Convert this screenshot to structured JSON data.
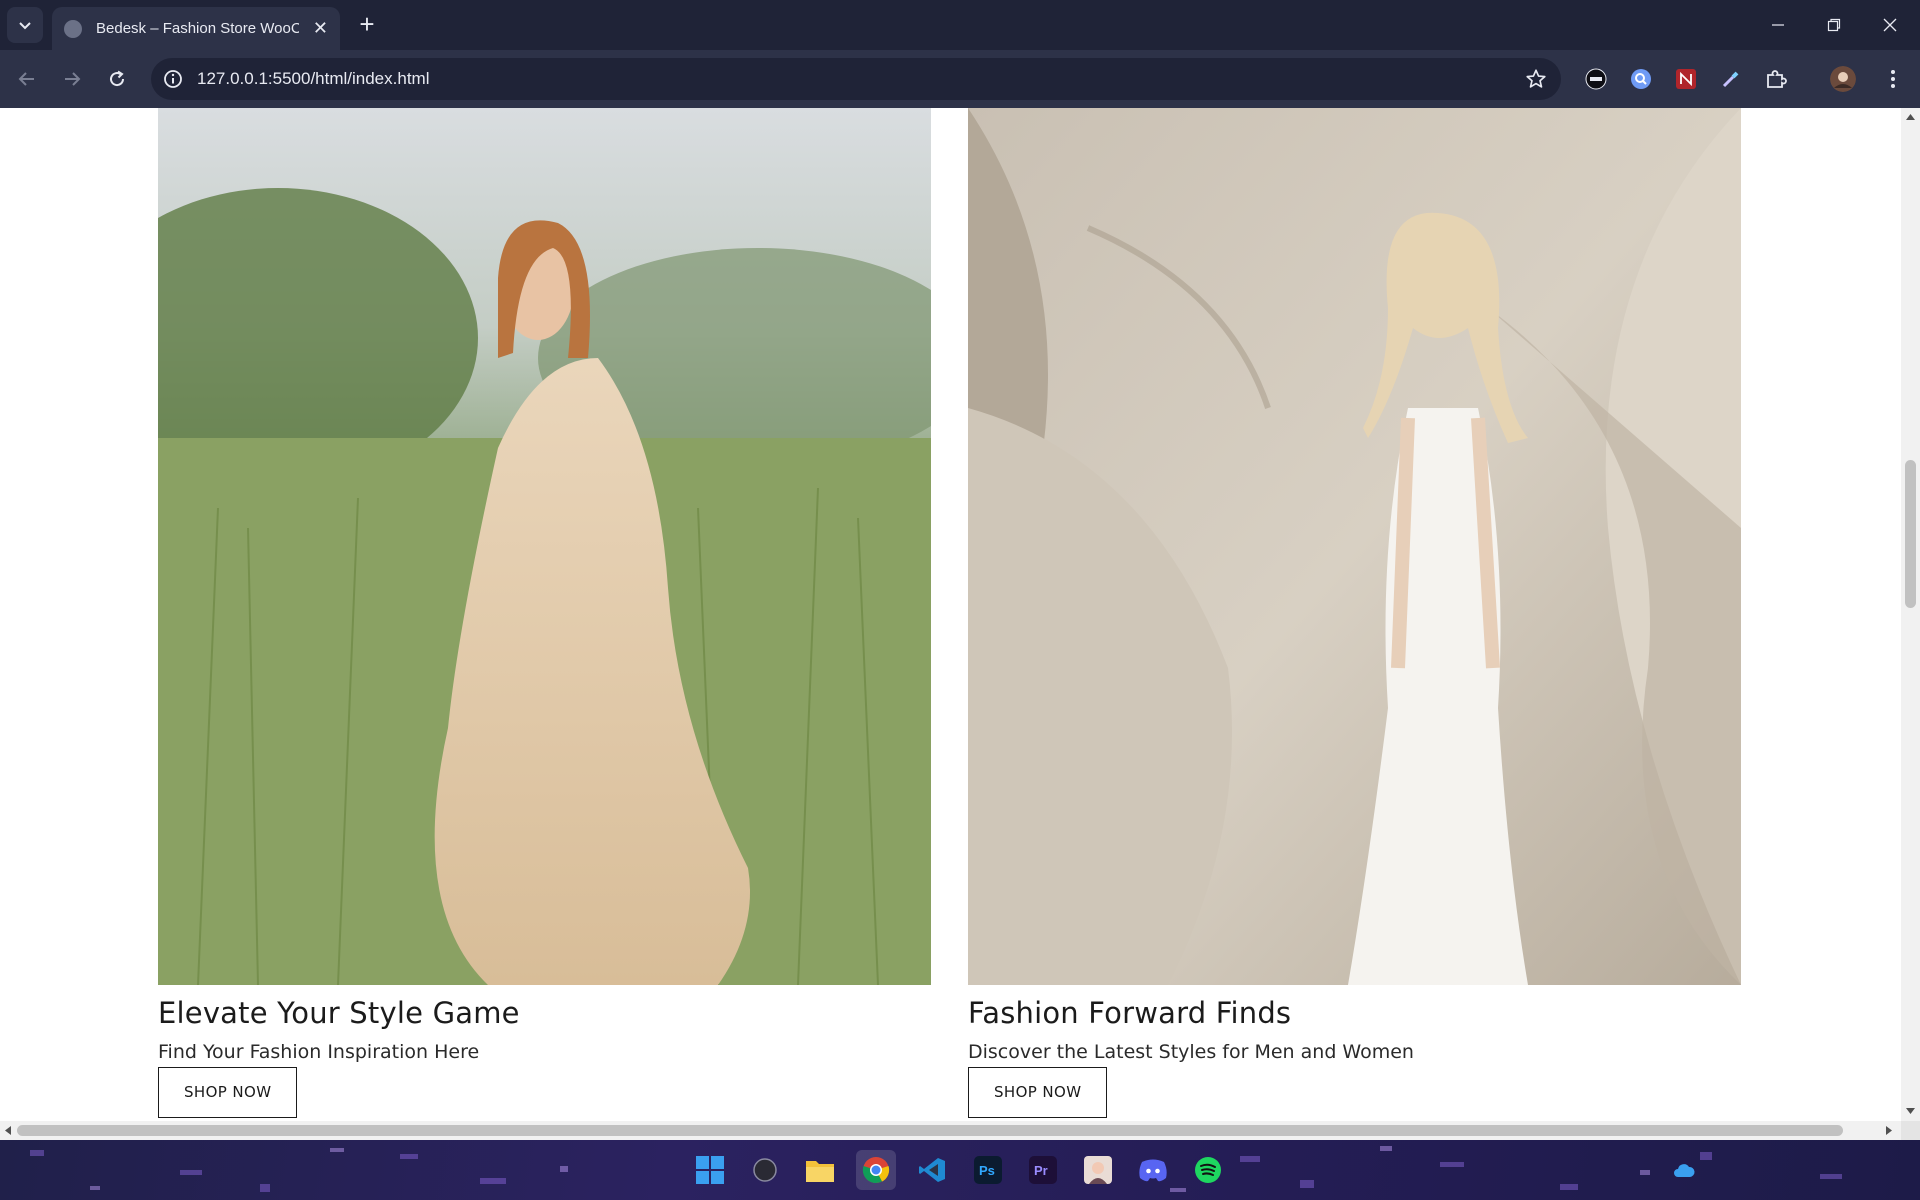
{
  "browser": {
    "tab_title": "Bedesk – Fashion Store WooCommerce",
    "tab_close": "✕",
    "new_tab": "+",
    "url": "127.0.0.1:5500/html/index.html",
    "theme_color": "#1f2337"
  },
  "cards": [
    {
      "title": "Elevate Your Style Game",
      "subtitle": "Find Your Fashion Inspiration Here",
      "button": "SHOP NOW",
      "image": "woman-in-beige-dress-in-tall-grass"
    },
    {
      "title": "Fashion Forward Finds",
      "subtitle": "Discover the Latest Styles for Men and Women",
      "button": "SHOP NOW",
      "image": "woman-in-white-dress-among-sandstone-rocks"
    }
  ],
  "taskbar": {
    "icons": [
      "windows-start-icon",
      "search-icon",
      "file-explorer-icon",
      "chrome-icon",
      "vscode-icon",
      "photoshop-icon",
      "premiere-icon",
      "app-icon",
      "discord-icon",
      "spotify-icon"
    ],
    "ps_label": "Ps",
    "pr_label": "Pr"
  }
}
